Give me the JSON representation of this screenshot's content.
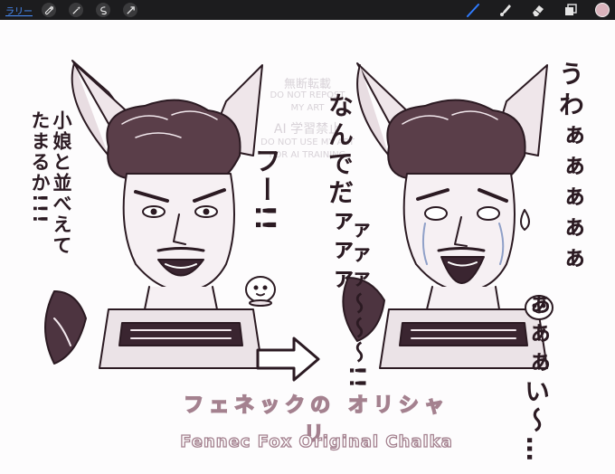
{
  "toolbar": {
    "gallery_label": "ラリー",
    "left_tools": [
      "wrench-icon",
      "magic-wand-icon",
      "selection-icon",
      "transform-arrow-icon"
    ],
    "right_tools": [
      "brush-icon",
      "smudge-icon",
      "eraser-icon",
      "layers-icon"
    ],
    "active_color": "#d9b3bc",
    "active_tool_color": "#2f7bff"
  },
  "artwork": {
    "left_bubble": "小娘と並べえて\nたまるか!!!",
    "left_exclaim": "フー!!",
    "right_bubble_1": "なんでだァァァ",
    "right_bubble_2": "ァァァ～～～!!",
    "right_bubble_3": "うわぁぁぁぁぁ",
    "right_bubble_4": "ぁぁぁい～…",
    "title_japanese": "フェネックの オリシャリ",
    "title_english": "Fennec Fox Original Chalka",
    "watermark": {
      "line1": "無断転載",
      "line2": "DO NOT REPOST",
      "line3": "MY ART",
      "line4": "AI 学習禁止",
      "line5": "DO NOT USE MY ART",
      "line6": "FOR AI TRAINING"
    }
  }
}
